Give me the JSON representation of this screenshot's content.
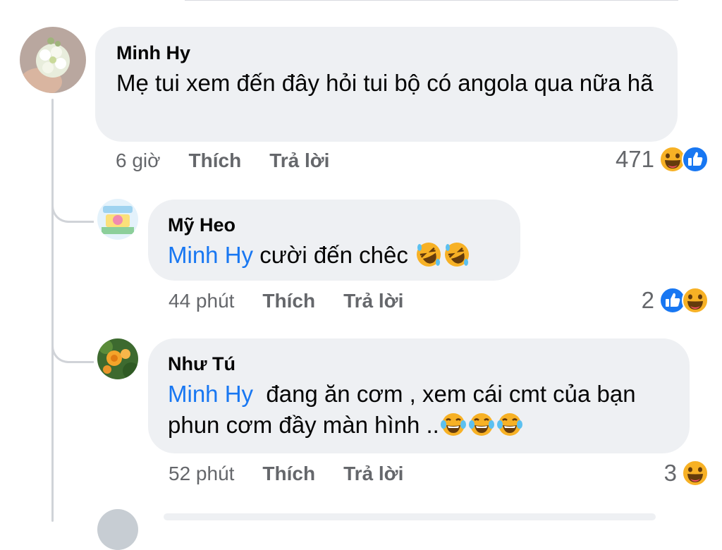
{
  "comments": [
    {
      "author": "Minh Hy",
      "text": "Mẹ tui xem đến đây hỏi tui bộ có angola qua nữa hã",
      "time": "6 giờ",
      "like_label": "Thích",
      "reply_label": "Trả lời",
      "reaction_count": "471",
      "reactions": [
        "haha-icon",
        "like-icon"
      ]
    },
    {
      "author": "Mỹ Heo",
      "mention": "Minh Hy",
      "text": "cười đến chêc",
      "emojis": [
        "rofl-emoji",
        "rofl-emoji"
      ],
      "time": "44 phút",
      "like_label": "Thích",
      "reply_label": "Trả lời",
      "reaction_count": "2",
      "reactions": [
        "like-icon",
        "haha-icon"
      ]
    },
    {
      "author": "Như Tú",
      "mention": "Minh Hy",
      "text": "đang ăn cơm , xem cái cmt của bạn phun cơm đầy màn hình ..",
      "emojis": [
        "tears-of-joy-emoji",
        "tears-of-joy-emoji",
        "tears-of-joy-emoji"
      ],
      "time": "52 phút",
      "like_label": "Thích",
      "reply_label": "Trả lời",
      "reaction_count": "3",
      "reactions": [
        "haha-icon"
      ]
    }
  ],
  "colors": {
    "bubble": "#eef0f3",
    "mention": "#1877f2",
    "meta": "#65676b",
    "like": "#1877f2",
    "haha": "#f7b125"
  }
}
